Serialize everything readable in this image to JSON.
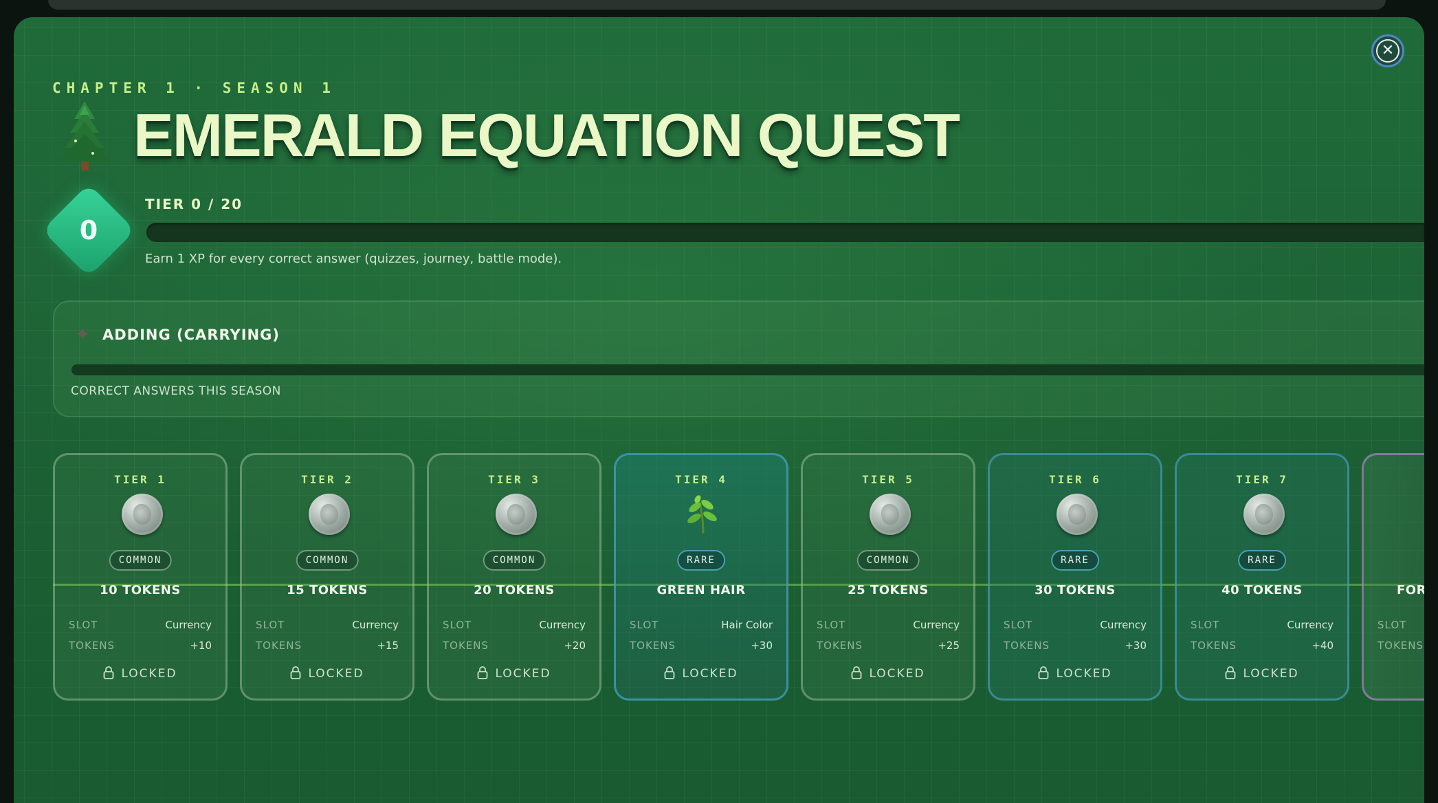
{
  "header": {
    "subtitle": "CHAPTER 1 · SEASON 1",
    "title": "EMERALD EQUATION QUEST",
    "tree_icon": "evergreen-tree-icon"
  },
  "close_button": {
    "icon": "close-icon",
    "glyph": "✕"
  },
  "progress": {
    "level": "0",
    "tier_text": "TIER 0 / 20",
    "tier_fraction": 0,
    "note": "Earn 1 XP for every correct answer (quizzes, journey, battle mode)."
  },
  "skill": {
    "icon": "sparkle-icon",
    "glyph": "✦",
    "name": "ADDING (CARRYING)",
    "caption": "CORRECT ANSWERS THIS SEASON",
    "fraction": 0
  },
  "labels": {
    "slot": "SLOT",
    "tokens": "TOKENS",
    "locked": "LOCKED"
  },
  "tiers": [
    {
      "tier": "TIER 1",
      "rarity": "COMMON",
      "reward": "10 TOKENS",
      "slot": "Currency",
      "tokens": "+10",
      "icon": "coin-icon"
    },
    {
      "tier": "TIER 2",
      "rarity": "COMMON",
      "reward": "15 TOKENS",
      "slot": "Currency",
      "tokens": "+15",
      "icon": "coin-icon"
    },
    {
      "tier": "TIER 3",
      "rarity": "COMMON",
      "reward": "20 TOKENS",
      "slot": "Currency",
      "tokens": "+20",
      "icon": "coin-icon"
    },
    {
      "tier": "TIER 4",
      "rarity": "RARE",
      "reward": "GREEN HAIR",
      "slot": "Hair Color",
      "tokens": "+30",
      "icon": "leaf-icon"
    },
    {
      "tier": "TIER 5",
      "rarity": "COMMON",
      "reward": "25 TOKENS",
      "slot": "Currency",
      "tokens": "+25",
      "icon": "coin-icon"
    },
    {
      "tier": "TIER 6",
      "rarity": "RARE",
      "reward": "30 TOKENS",
      "slot": "Currency",
      "tokens": "+30",
      "icon": "coin-icon"
    },
    {
      "tier": "TIER 7",
      "rarity": "RARE",
      "reward": "40 TOKENS",
      "slot": "Currency",
      "tokens": "+40",
      "icon": "coin-icon"
    },
    {
      "tier": "",
      "rarity": "",
      "reward": "FORE",
      "slot": "",
      "tokens": "",
      "icon": ""
    }
  ],
  "colors": {
    "accent": "#37d59a",
    "title": "#eaf7c6",
    "subtitle": "#c6ee8a",
    "panel": "#1d6436",
    "rare_border": "#46a0be"
  }
}
